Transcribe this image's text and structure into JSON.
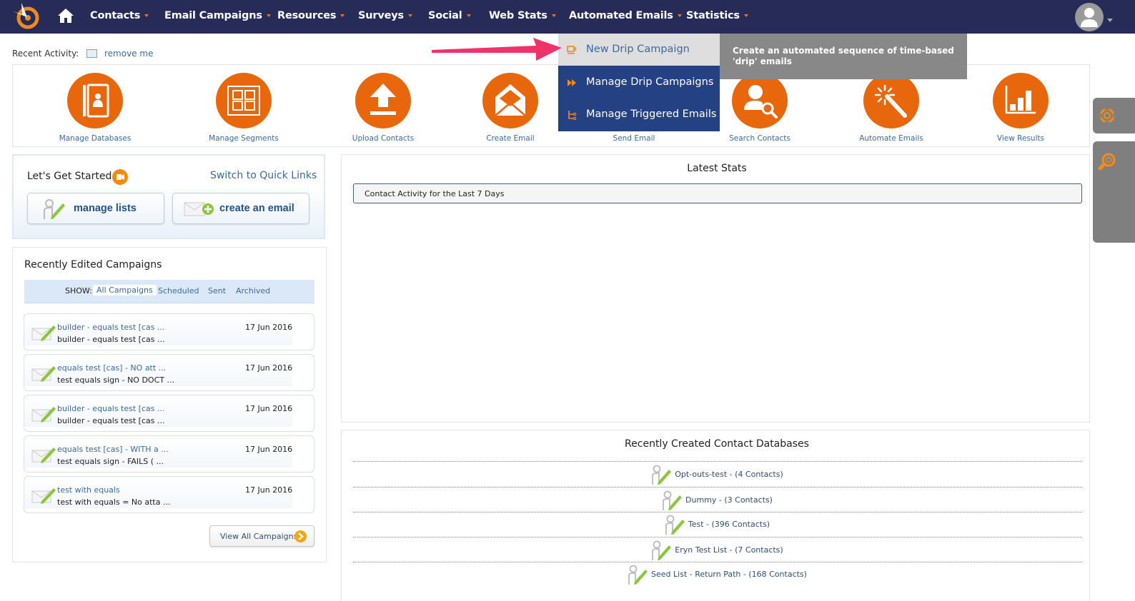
{
  "topnav": {
    "items": [
      {
        "label": "Contacts"
      },
      {
        "label": "Email Campaigns"
      },
      {
        "label": "Resources"
      },
      {
        "label": "Surveys"
      },
      {
        "label": "Social"
      },
      {
        "label": "Web Stats"
      },
      {
        "label": "Automated Emails"
      },
      {
        "label": "Statistics"
      }
    ]
  },
  "recent_activity": {
    "label": "Recent Activity:",
    "link": "remove me"
  },
  "quick_icons": [
    {
      "label": "Manage Databases",
      "icon": "address-book-icon"
    },
    {
      "label": "Manage Segments",
      "icon": "segments-grid-icon"
    },
    {
      "label": "Upload Contacts",
      "icon": "upload-icon"
    },
    {
      "label": "Create Email",
      "icon": "envelope-open-icon"
    },
    {
      "label": "Send Email",
      "icon": "send-icon"
    },
    {
      "label": "Search Contacts",
      "icon": "user-search-icon"
    },
    {
      "label": "Automate Emails",
      "icon": "magic-wand-icon"
    },
    {
      "label": "View Results",
      "icon": "bar-chart-icon"
    }
  ],
  "automated_emails_menu": {
    "items": [
      {
        "label": "New Drip Campaign",
        "icon": "coffee-cup-icon",
        "active": true
      },
      {
        "label": "Manage Drip Campaigns",
        "icon": "fast-forward-icon"
      },
      {
        "label": "Manage Triggered Emails",
        "icon": "flow-branch-icon"
      }
    ],
    "tooltip": "Create an automated sequence of time-based 'drip' emails"
  },
  "get_started": {
    "title": "Let's Get Started",
    "switch_link": "Switch to Quick Links",
    "buttons": [
      {
        "label": "manage lists"
      },
      {
        "label": "create an email"
      }
    ]
  },
  "recent_campaigns": {
    "title": "Recently Edited Campaigns",
    "show_label": "SHOW:",
    "filters": [
      "All Campaigns",
      "Scheduled",
      "Sent",
      "Archived"
    ],
    "active_filter": "All Campaigns",
    "rows": [
      {
        "name": "builder - equals test [cas ...",
        "subject": "builder - equals test [cas ...",
        "date": "17 Jun 2016"
      },
      {
        "name": "equals test [cas] - NO att ...",
        "subject": "test equals sign - NO DOCT ...",
        "date": "17 Jun 2016"
      },
      {
        "name": "builder - equals test [cas ...",
        "subject": "builder - equals test [cas ...",
        "date": "17 Jun 2016"
      },
      {
        "name": "equals test [cas] - WITH a ...",
        "subject": "test equals sign - FAILS ( ...",
        "date": "17 Jun 2016"
      },
      {
        "name": "test with equals",
        "subject": "test with equals = No atta ...",
        "date": "17 Jun 2016"
      }
    ],
    "view_all": "View All Campaigns"
  },
  "latest_stats": {
    "title": "Latest Stats",
    "panel_label": "Contact Activity for the Last 7 Days"
  },
  "recent_databases": {
    "title": "Recently Created Contact Databases",
    "items": [
      {
        "label": "Opt-outs-test - (4 Contacts)"
      },
      {
        "label": "Dummy - (3 Contacts)"
      },
      {
        "label": "Test - (396 Contacts)"
      },
      {
        "label": "Eryn Test List - (7 Contacts)"
      },
      {
        "label": "Seed List - Return Path - (168 Contacts)"
      }
    ]
  },
  "colors": {
    "nav_bg": "#262c57",
    "accent_orange": "#e8660c",
    "dropdown_bg": "#244183",
    "link_blue": "#3b6aa0",
    "annotation_arrow": "#f0326a"
  }
}
